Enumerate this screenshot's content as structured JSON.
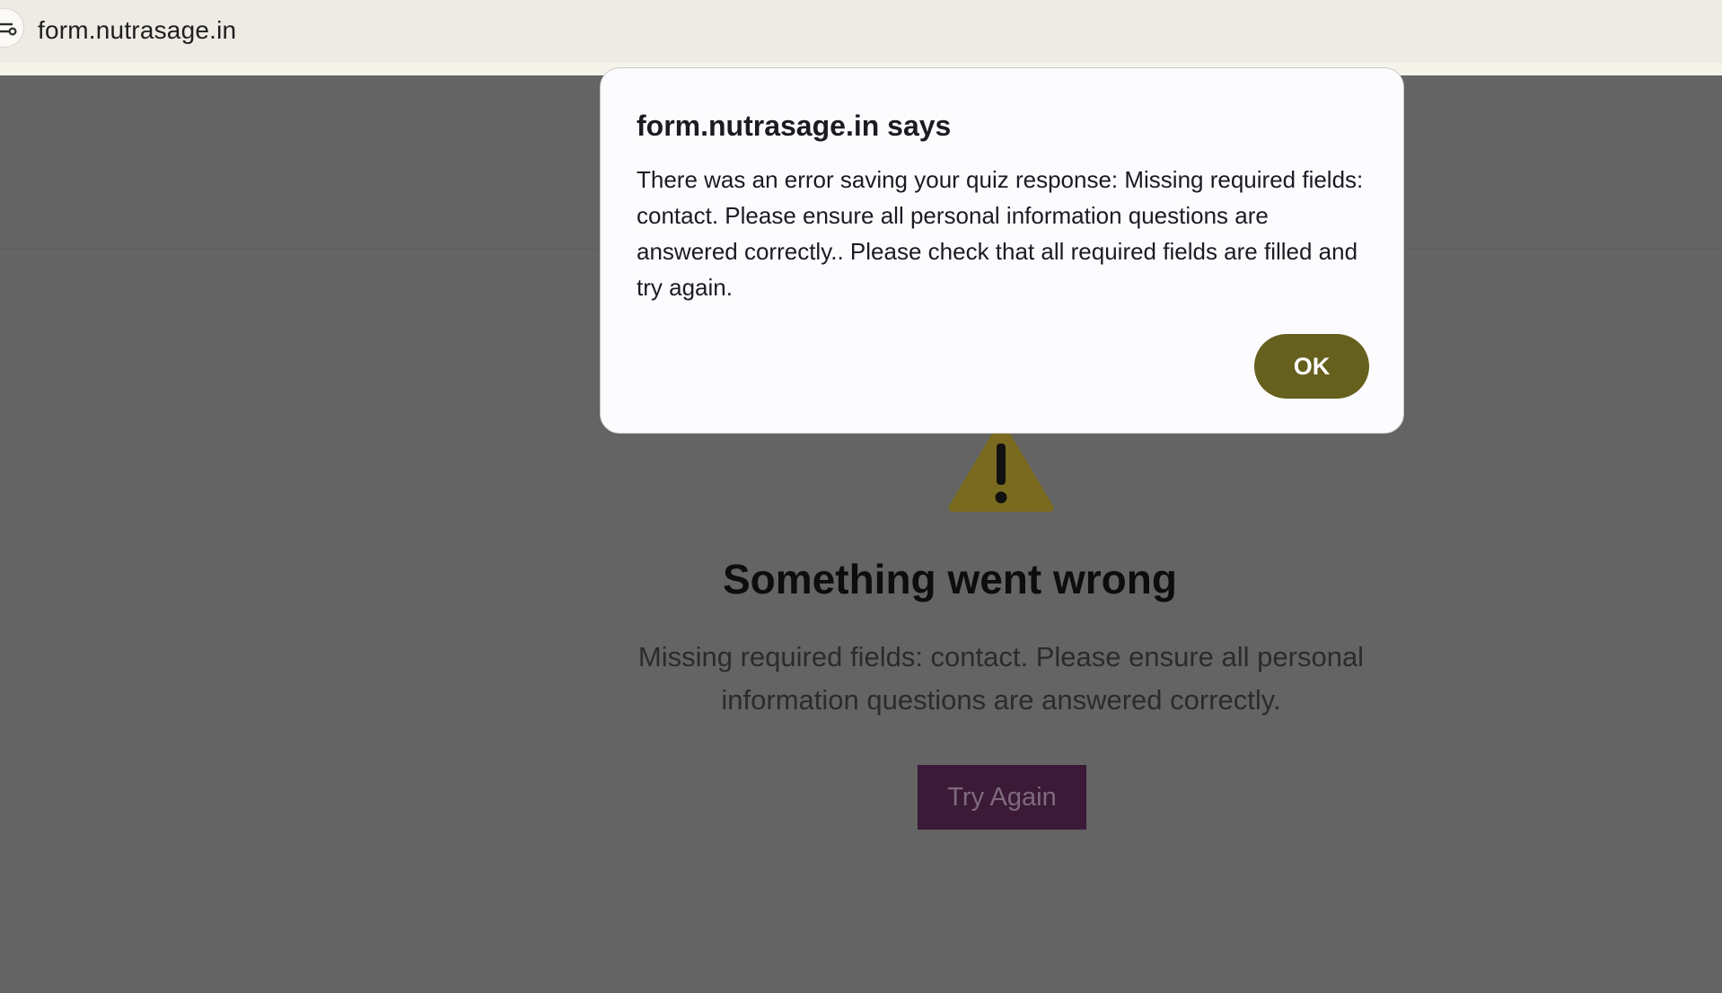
{
  "browser": {
    "url": "form.nutrasage.in",
    "site_controls_icon": "tune-icon"
  },
  "page": {
    "warning_icon": "warning-triangle-icon",
    "error_title": "Something went wrong",
    "error_message": "Missing required fields: contact. Please ensure all personal information questions are answered correctly.",
    "try_again_label": "Try Again"
  },
  "dialog": {
    "title": "form.nutrasage.in says",
    "message": "There was an error saving your quiz response: Missing required fields: contact. Please ensure all personal information questions are answered correctly.. Please check that all required fields are filled and try again.",
    "ok_label": "OK"
  },
  "colors": {
    "overlay": "#646464",
    "ok_button": "#66601e",
    "try_again_button": "#3b1a38",
    "warning": "#7a6a1f",
    "dialog_bg": "#fcfbfe"
  }
}
